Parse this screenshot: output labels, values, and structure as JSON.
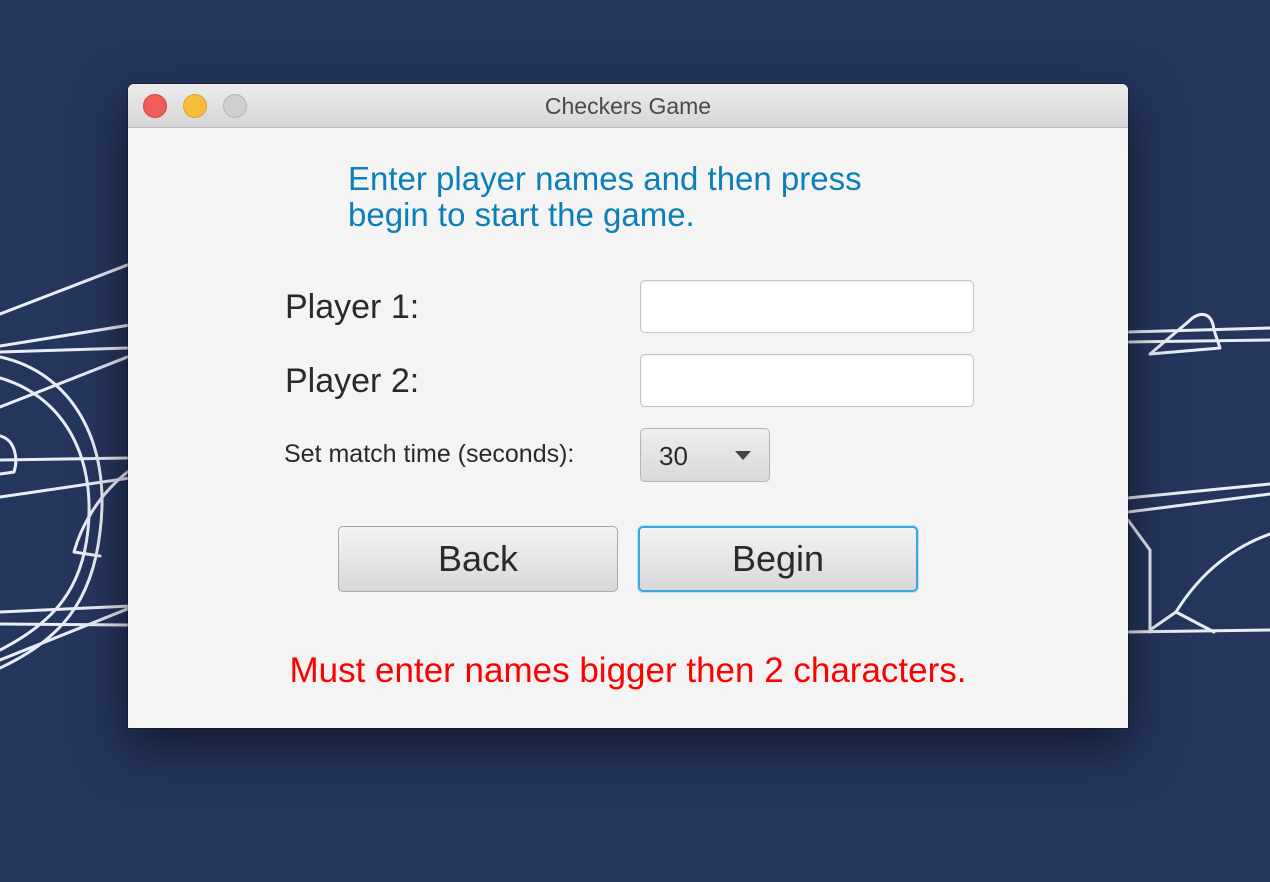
{
  "window": {
    "title": "Checkers Game"
  },
  "instructions": {
    "line1": "Enter player names and then press",
    "line2": "begin to start the game."
  },
  "form": {
    "player1_label": "Player 1:",
    "player1_value": "",
    "player2_label": "Player 2:",
    "player2_value": "",
    "match_time_label": "Set match time (seconds):",
    "match_time_value": "30"
  },
  "buttons": {
    "back_label": "Back",
    "begin_label": "Begin"
  },
  "error": {
    "message": "Must enter names bigger then 2 characters."
  },
  "icons": {
    "window_controls": [
      "close-icon",
      "minimize-icon",
      "maximize-icon"
    ],
    "dropdown": "chevron-down-icon"
  },
  "colors": {
    "desktop_background": "#25365d",
    "instruction_text": "#0d7fb8",
    "error_text": "#ff0000",
    "focus_ring": "#3aa6df",
    "close": "#ee5d58",
    "minimize": "#f6bd3b",
    "maximize_disabled": "#cfcfcf"
  }
}
